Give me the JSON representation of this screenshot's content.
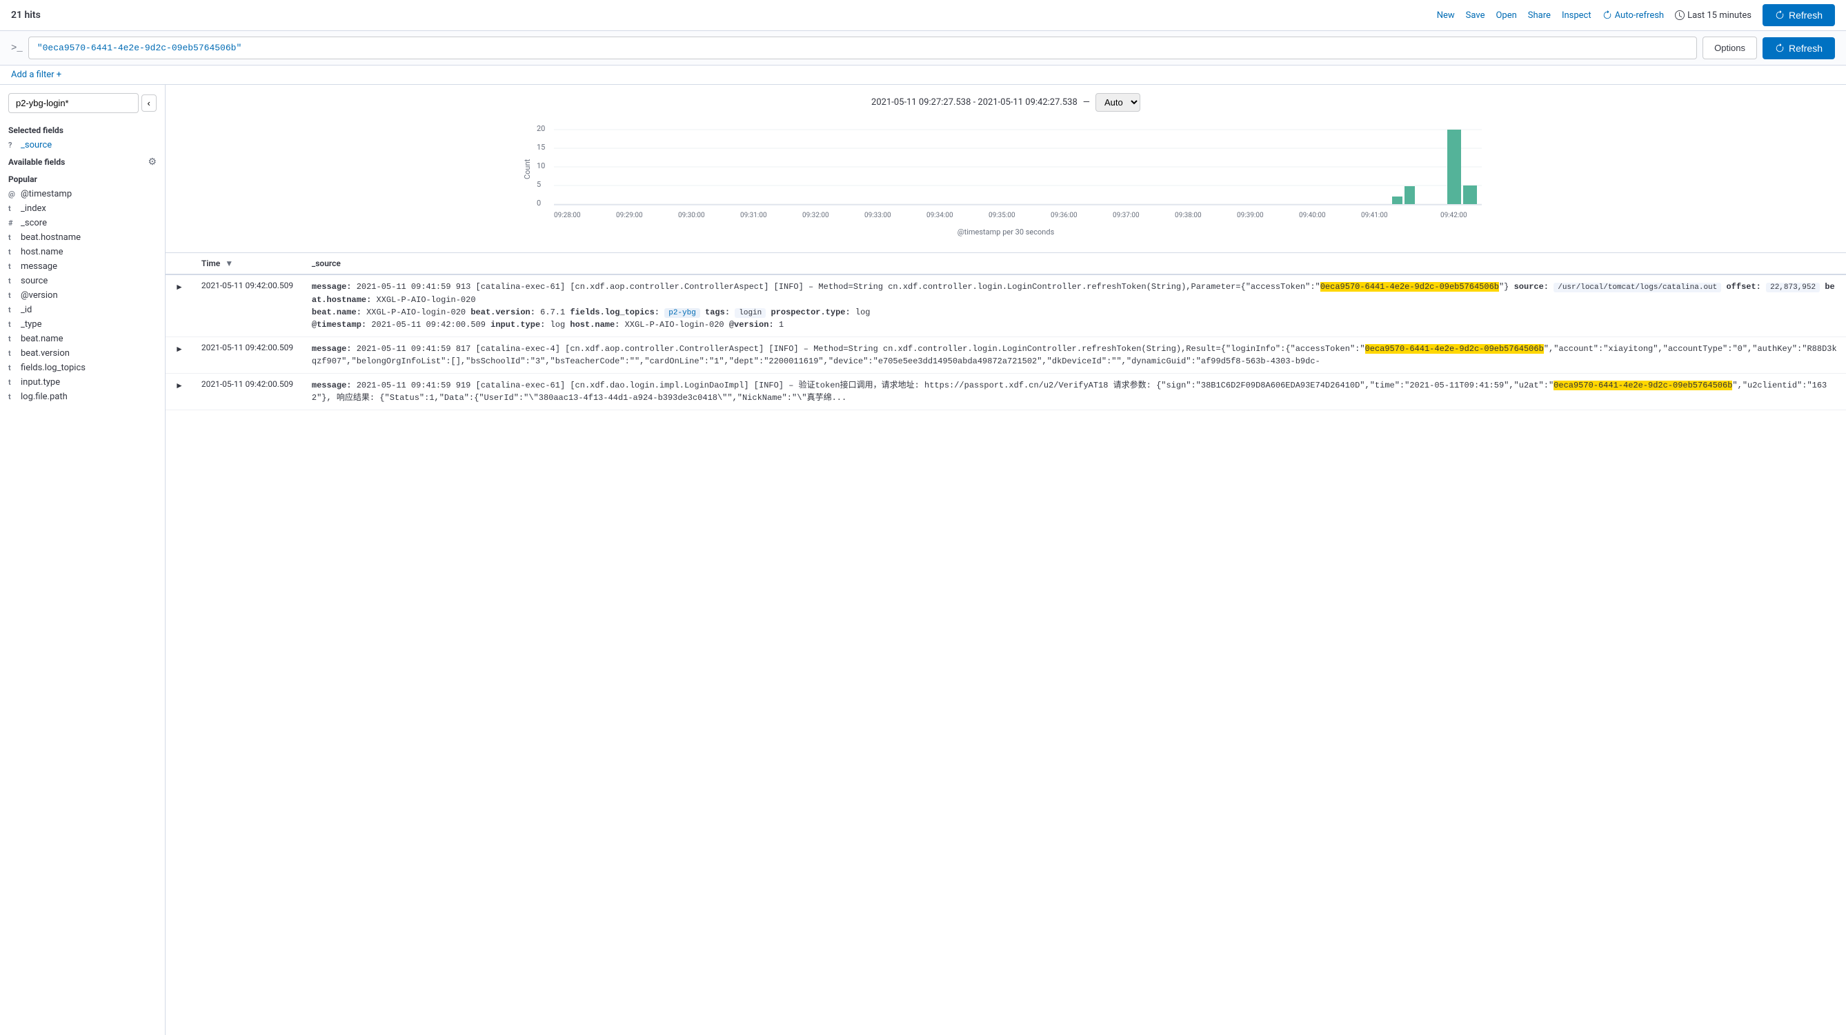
{
  "topbar": {
    "hits": "21 hits",
    "nav": {
      "new": "New",
      "save": "Save",
      "open": "Open",
      "share": "Share",
      "inspect": "Inspect",
      "auto_refresh": "Auto-refresh",
      "last_time": "Last 15 minutes"
    },
    "refresh": "Refresh"
  },
  "querybar": {
    "query": "\"0eca9570-6441-4e2e-9d2c-09eb5764506b\"",
    "options": "Options"
  },
  "filter": {
    "add_filter": "Add a filter +"
  },
  "sidebar": {
    "index": "p2-ybg-login*",
    "selected_fields_title": "Selected fields",
    "selected_fields": [
      {
        "type": "?",
        "name": "_source"
      }
    ],
    "available_fields_title": "Available fields",
    "popular_title": "Popular",
    "popular_fields": [
      {
        "type": "@",
        "name": "@timestamp"
      },
      {
        "type": "t",
        "name": "_index"
      },
      {
        "type": "#",
        "name": "_score"
      },
      {
        "type": "t",
        "name": "beat.hostname"
      },
      {
        "type": "t",
        "name": "host.name"
      },
      {
        "type": "t",
        "name": "message"
      },
      {
        "type": "t",
        "name": "source"
      },
      {
        "type": "t",
        "name": "@version"
      },
      {
        "type": "t",
        "name": "_id"
      },
      {
        "type": "t",
        "name": "_type"
      },
      {
        "type": "t",
        "name": "beat.name"
      },
      {
        "type": "t",
        "name": "beat.version"
      },
      {
        "type": "t",
        "name": "fields.log_topics"
      },
      {
        "type": "t",
        "name": "input.type"
      },
      {
        "type": "t",
        "name": "log.file.path"
      }
    ]
  },
  "histogram": {
    "time_range": "2021-05-11 09:27:27.538 - 2021-05-11 09:42:27.538",
    "separator": "—",
    "interval": "Auto",
    "y_label": "Count",
    "x_label": "@timestamp per 30 seconds",
    "y_ticks": [
      "20",
      "15",
      "10",
      "5",
      "0"
    ],
    "x_ticks": [
      "09:28:00",
      "09:29:00",
      "09:30:00",
      "09:31:00",
      "09:32:00",
      "09:33:00",
      "09:34:00",
      "09:35:00",
      "09:36:00",
      "09:37:00",
      "09:38:00",
      "09:39:00",
      "09:40:00",
      "09:41:00",
      "09:42:00"
    ]
  },
  "table": {
    "col_time": "Time",
    "col_source": "_source",
    "rows": [
      {
        "time": "2021-05-11 09:42:00.509",
        "source_parts": [
          {
            "label": "message:",
            "value": " 2021-05-11 09:41:59 913 [catalina-exec-61] [cn.xdf.aop.controller.ControllerAspect] [INFO] – Method=String cn.xdf.controller.login.LoginController.refreshToken(String),Parameter={\"accessToken\":\""
          },
          {
            "highlight": "0eca9570-6441-4e2e-9d2c-09eb5764506b"
          },
          {
            "value": "\"} "
          },
          {
            "label": "source:",
            "value": " /usr/local/tomcat/logs/catalina.out "
          },
          {
            "label": "offset:",
            "value": " 22,873,952 "
          },
          {
            "label": "beat.hostname:",
            "value": " XXGL-P-AIO-login-020 beat.name: XXGL-P-AIO-login-020 "
          },
          {
            "label": "beat.version:",
            "value": " 6.7.1 "
          },
          {
            "label": "fields.log_topics:",
            "value": " p2-ybg "
          },
          {
            "label": "tags:",
            "value": " login "
          },
          {
            "label": "prospector.type:",
            "value": " log "
          },
          {
            "label": "@timestamp:",
            "value": " 2021-05-11 09:42:00.509 "
          },
          {
            "label": "input.type:",
            "value": " log "
          },
          {
            "label": "host.name:",
            "value": " XXGL-P-AIO-login-020 "
          },
          {
            "label": "@version:",
            "value": " 1"
          }
        ]
      },
      {
        "time": "2021-05-11 09:42:00.509",
        "source_parts": [
          {
            "label": "message:",
            "value": " 2021-05-11 09:41:59 817 [catalina-exec-4] [cn.xdf.aop.controller.ControllerAspect] [INFO] – Method=String cn.xdf.controller.login.LoginController.refreshToken(String),Result={\"loginInfo\":{\"accessToken\":\""
          },
          {
            "highlight": "0eca9570-6441-4e2e-9d2c-09eb5764506b"
          },
          {
            "value": "\",\"account\":\"xiayitong\",\"accountType\":\"0\",\"authKey\":\"R88D3kqzf907\",\"belongOrgInfoList\":[],\"bsSchoolId\":\"3\",\"bsTeacherCode\":\"\",\"cardOnLine\":\"1\",\"dept\":\"2200011619\",\"device\":\"e705e5ee3dd14950abda49872a721502\",\"dkDeviceId\":\"\",\"dynamicGuid\":\"af99d5f8-563b-4303-b9dc-"
          }
        ]
      },
      {
        "time": "2021-05-11 09:42:00.509",
        "source_parts": [
          {
            "label": "message:",
            "value": " 2021-05-11 09:41:59 919 [catalina-exec-61] [cn.xdf.dao.login.impl.LoginDaoImpl] [INFO] – 验证token接口调用，请求地址: https://passport.xdf.cn/u2/VerifyAT18 请求参数: {\"sign\":\"38B1C6D2F09D8A606EDA93E74D26410D\",\"time\":\"2021-05-11T09:41:59\",\"u2at\":\""
          },
          {
            "highlight": "0eca9570-6441-4e2e-9d2c-09eb5764506b"
          },
          {
            "value": "\",\"u2clientid\":\"1632\"}, 响应结果: {\"Status\":1,\"Data\":{\"UserId\":\"\\\"380aac13-4f13-44d1-a924-b393de3c0418\\\"\",\"NickName\":\"\\\"真芋绵..."
          }
        ]
      }
    ]
  }
}
